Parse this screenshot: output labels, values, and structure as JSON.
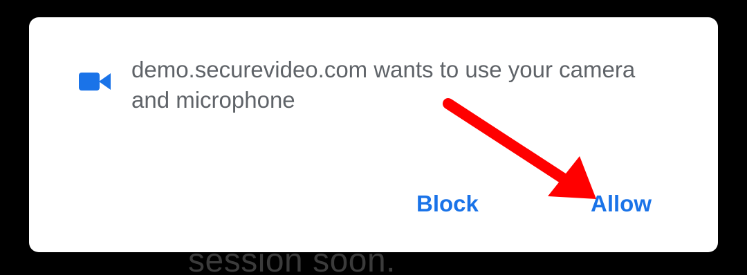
{
  "background": {
    "behind_text": "session soon."
  },
  "dialog": {
    "message": "demo.securevideo.com wants to use your camera and microphone",
    "icon": "video-camera-icon",
    "buttons": {
      "block": "Block",
      "allow": "Allow"
    }
  },
  "annotation": {
    "arrow_color": "#ff0000",
    "points_to": "allow-button"
  },
  "colors": {
    "accent": "#1a73e8",
    "message_text": "#5f6368",
    "dialog_bg": "#ffffff",
    "backdrop": "#000000"
  }
}
